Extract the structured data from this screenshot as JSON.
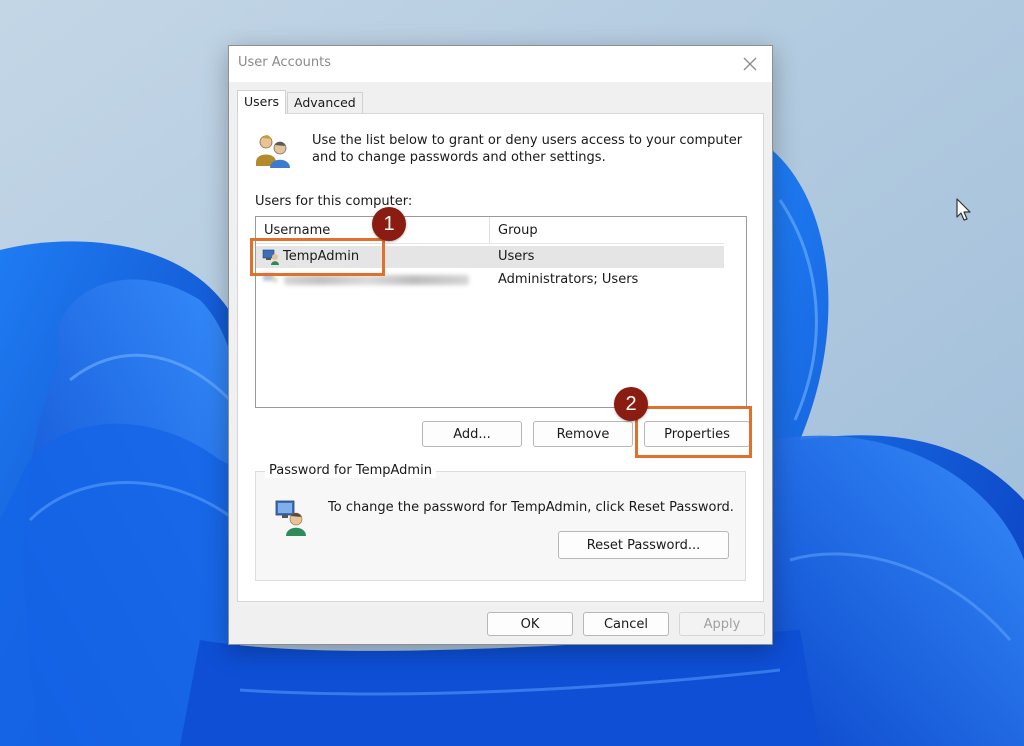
{
  "window": {
    "title": "User Accounts",
    "close_icon": "close-icon"
  },
  "tabs": [
    {
      "label": "Users",
      "active": true
    },
    {
      "label": "Advanced",
      "active": false
    }
  ],
  "users_tab": {
    "intro_text": "Use the list below to grant or deny users access to your computer and to change passwords and other settings.",
    "users_label": "Users for this computer:",
    "columns": [
      "Username",
      "Group"
    ],
    "rows": [
      {
        "username": "TempAdmin",
        "group": "Users",
        "selected": true
      },
      {
        "username": "",
        "group": "Administrators; Users",
        "selected": false,
        "obscured": true
      }
    ],
    "buttons": {
      "add": "Add...",
      "remove": "Remove",
      "properties": "Properties"
    },
    "password_group": {
      "legend": "Password for TempAdmin",
      "text": "To change the password for TempAdmin, click Reset Password.",
      "reset_button": "Reset Password..."
    }
  },
  "footer_buttons": {
    "ok": "OK",
    "cancel": "Cancel",
    "apply": "Apply",
    "apply_enabled": false
  },
  "annotations": [
    {
      "number": "1",
      "target": "TempAdmin"
    },
    {
      "number": "2",
      "target": "Properties"
    }
  ],
  "colors": {
    "highlight": "#e2702d",
    "marker": "#8a1c12",
    "selection": "#e5e5e5"
  }
}
